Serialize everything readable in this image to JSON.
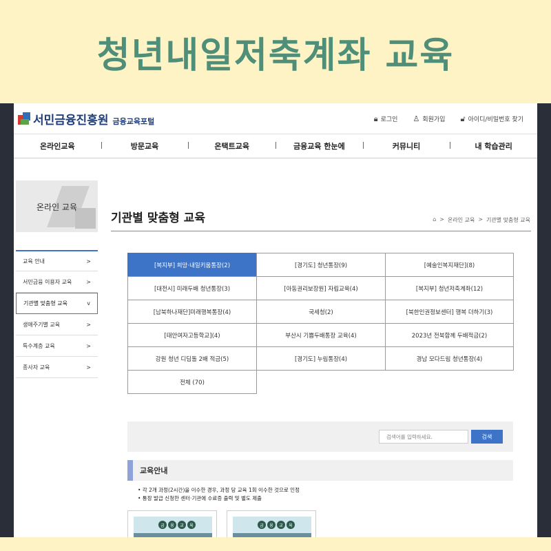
{
  "banner": {
    "title": "청년내일저축계좌 교육"
  },
  "header": {
    "logo_name": "서민금융진흥원",
    "logo_sub": "금융교육포털",
    "login": "로그인",
    "signup": "회원가입",
    "find": "아이디/비밀번호 찾기"
  },
  "gnb": [
    "온라인교육",
    "방문교육",
    "온택트교육",
    "금융교육 한눈에",
    "커뮤니티",
    "내 학습관리"
  ],
  "lnb": {
    "title": "온라인 교육",
    "items": [
      {
        "label": "교육 안내",
        "arrow": ">"
      },
      {
        "label": "서민금융 이용자 교육",
        "arrow": ">"
      },
      {
        "label": "기관별 맞춤형 교육",
        "arrow": "v"
      },
      {
        "label": "생애주기별 교육",
        "arrow": ">"
      },
      {
        "label": "특수계층 교육",
        "arrow": ">"
      },
      {
        "label": "종사자 교육",
        "arrow": ">"
      }
    ]
  },
  "page": {
    "title": "기관별 맞춤형 교육",
    "crumb_home": "⌂",
    "crumb_1": "온라인 교육",
    "crumb_2": "기관별 맞춤형 교육"
  },
  "categories": [
    "[복지부] 희망·내일키움통장(2)",
    "[경기도] 청년통장(9)",
    "[예술인복지재단](8)",
    "[대전시] 미래두배 청년통장(3)",
    "[아동권리보장원] 자립교육(4)",
    "[복지부] 청년저축계좌(12)",
    "[남북하나재단]미래행복통장(4)",
    "국세청(2)",
    "[북한인권정보센터] 행복 더하기(3)",
    "[태안여자고등학교](4)",
    "부산시 기쁨두배통장 교육(4)",
    "2023년 전북함께 두배적금(2)",
    "강원 청년 디딤돌 2배 적금(5)",
    "[경기도] 누림통장(4)",
    "경남 모다드림 청년통장(4)",
    "전체 (70)"
  ],
  "search": {
    "placeholder": "검색어를 입력하세요.",
    "button": "검색"
  },
  "guide": {
    "title": "교육안내",
    "note1": "• 각 2개 과정(2시간)을 이수한 경우, 과정 당 교육 1회 이수한 것으로 인정",
    "note2": "• 통장 발급 신청한 센터·기관에 수료증 출력 및 별도 제출"
  },
  "thumb_badge": [
    "금",
    "융",
    "교",
    "육"
  ]
}
